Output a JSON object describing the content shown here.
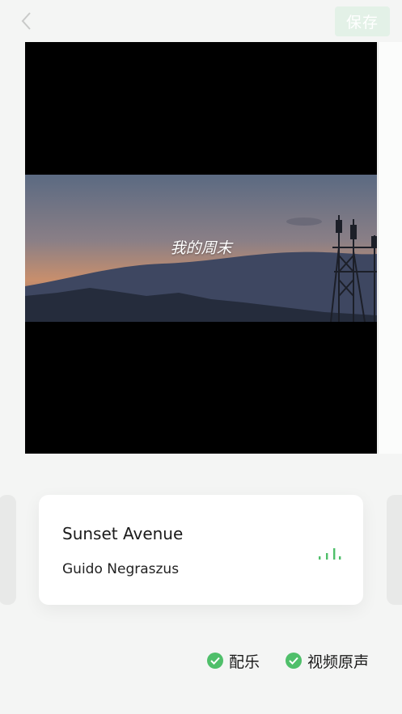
{
  "header": {
    "back_icon": "chevron-left-icon",
    "save_label": "保存",
    "save_color": "#e3f1e7"
  },
  "video": {
    "caption": "我的周末"
  },
  "music": {
    "title": "Sunset Avenue",
    "artist": "Guido Negraszus",
    "playing_icon": "equalizer-icon",
    "accent_color": "#4fbf6a"
  },
  "options": [
    {
      "label": "配乐",
      "checked": true
    },
    {
      "label": "视频原声",
      "checked": true
    }
  ]
}
